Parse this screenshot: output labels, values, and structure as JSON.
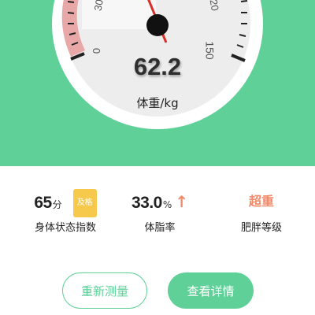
{
  "gauge": {
    "tick_labels": {
      "left_top": "30",
      "left_bottom": "0",
      "right_top": "20",
      "right_bottom": "150"
    },
    "weight_value": "62.2",
    "unit_label": "体重/kg"
  },
  "stats": {
    "score": {
      "value": "65",
      "unit": "分",
      "badge": "及格",
      "label": "身体状态指数"
    },
    "body_fat": {
      "value": "33.0",
      "unit": "%",
      "trend_icon": "arrow-up-icon",
      "label": "体脂率"
    },
    "obesity": {
      "value": "超重",
      "label": "肥胖等级"
    }
  },
  "buttons": {
    "retest": "重新测量",
    "view_details": "查看详情"
  },
  "colors": {
    "brand_green": "#5fd198",
    "warning_orange": "#f08a68",
    "badge_yellow": "#f6c84b",
    "needle_red": "#d7302a"
  }
}
